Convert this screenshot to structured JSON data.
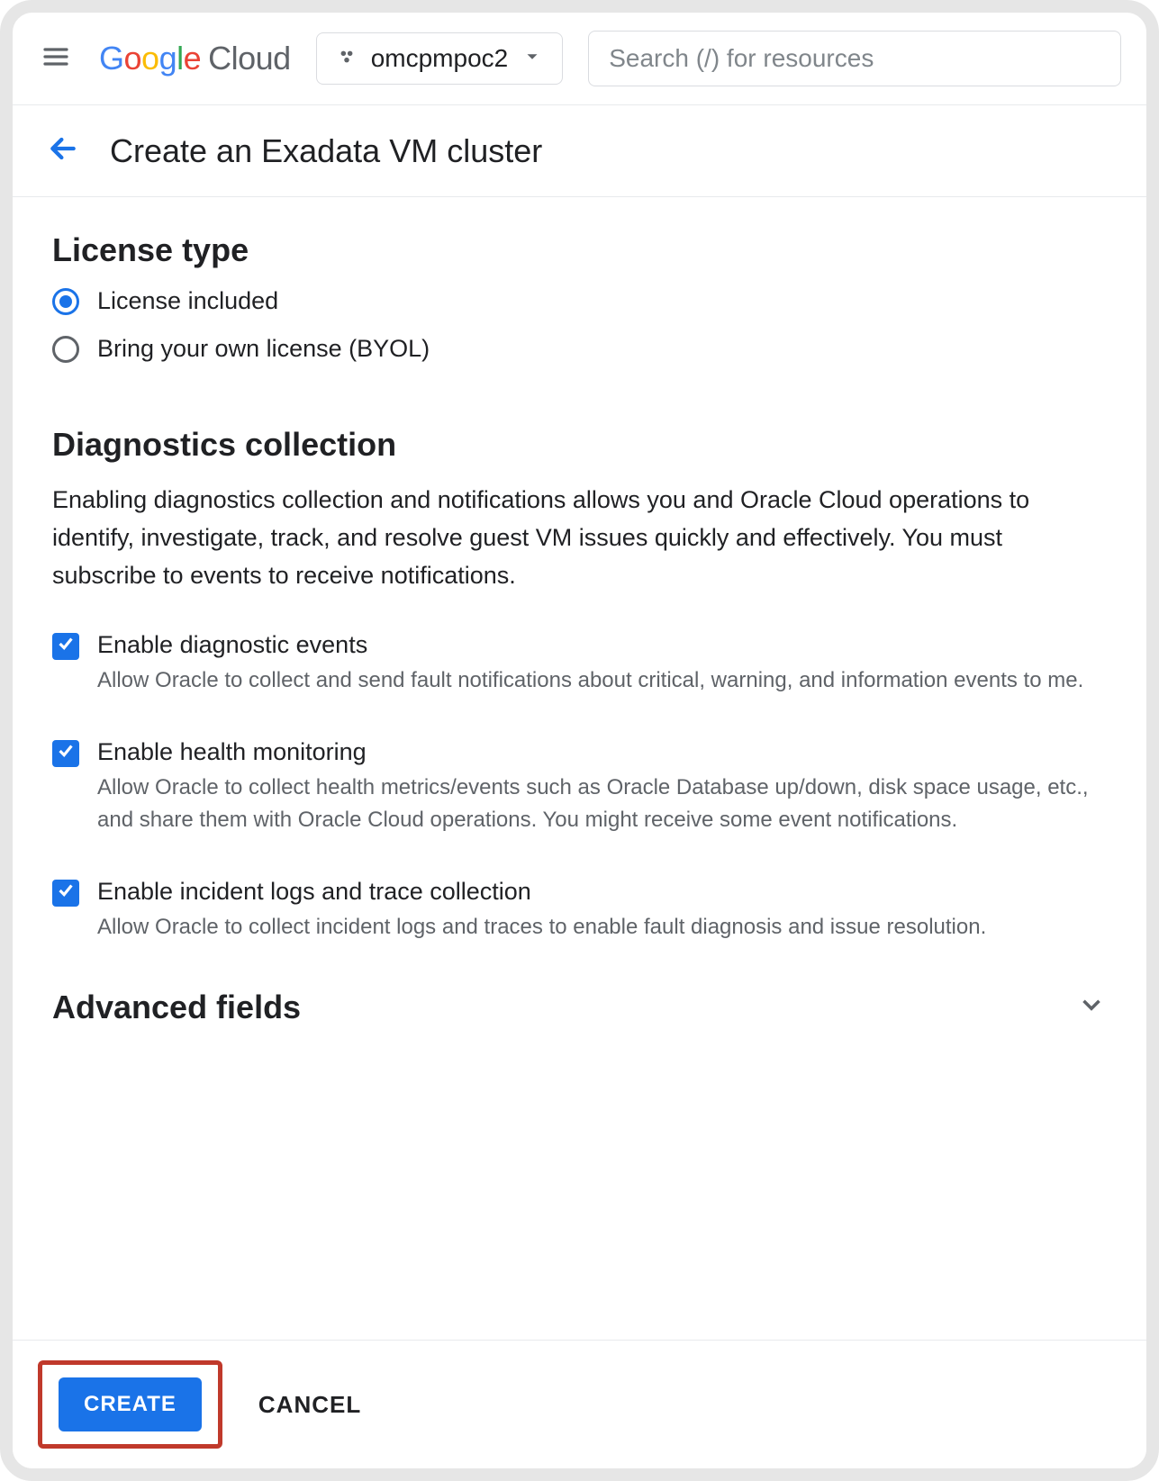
{
  "header": {
    "brand_word": "Google",
    "brand_suffix": "Cloud",
    "project_name": "omcpmpoc2",
    "search_placeholder": "Search (/) for resources"
  },
  "page": {
    "title": "Create an Exadata VM cluster"
  },
  "license": {
    "heading": "License type",
    "options": [
      {
        "id": "license-included",
        "label": "License included",
        "selected": true
      },
      {
        "id": "byol",
        "label": "Bring your own license (BYOL)",
        "selected": false
      }
    ]
  },
  "diagnostics": {
    "heading": "Diagnostics collection",
    "description": "Enabling diagnostics collection and notifications allows you and Oracle Cloud operations to identify, investigate, track, and resolve guest VM issues quickly and effectively. You must subscribe to events to receive notifications.",
    "items": [
      {
        "id": "diag-events",
        "label": "Enable diagnostic events",
        "sub": "Allow Oracle to collect and send fault notifications about critical, warning, and information events to me.",
        "checked": true
      },
      {
        "id": "health-monitoring",
        "label": "Enable health monitoring",
        "sub": "Allow Oracle to collect health metrics/events such as Oracle Database up/down, disk space usage, etc., and share them with Oracle Cloud operations. You might receive some event notifications.",
        "checked": true
      },
      {
        "id": "incident-logs",
        "label": "Enable incident logs and trace collection",
        "sub": "Allow Oracle to collect incident logs and traces to enable fault diagnosis and issue resolution.",
        "checked": true
      }
    ]
  },
  "advanced": {
    "heading": "Advanced fields",
    "expanded": false
  },
  "footer": {
    "create_label": "CREATE",
    "cancel_label": "CANCEL"
  }
}
